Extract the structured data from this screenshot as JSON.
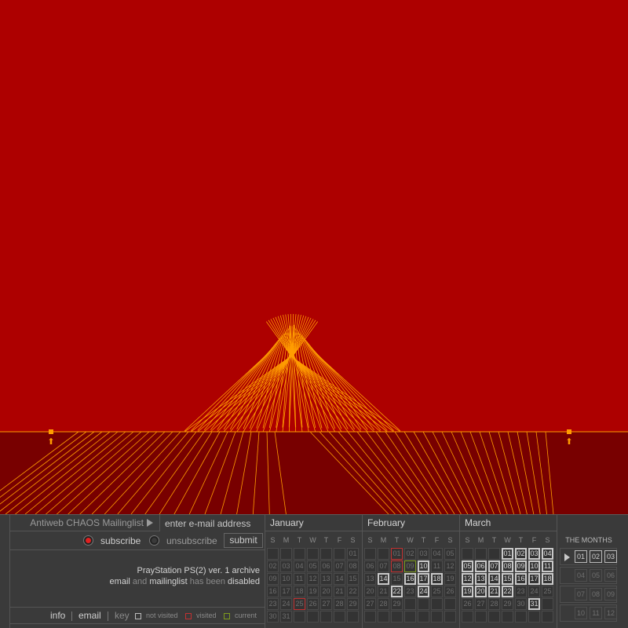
{
  "colors": {
    "background": "#ad0000",
    "floor": "#780000",
    "line": "#ff9d00",
    "panel": "#3a3a3a"
  },
  "markers": [
    {
      "name": "left-handle",
      "icon": "arrow-up-icon",
      "glyph": "⬆"
    },
    {
      "name": "right-handle",
      "icon": "arrow-up-icon",
      "glyph": "⬆"
    }
  ],
  "mailinglist": {
    "label": "Antiweb CHAOS Mailinglist",
    "email_placeholder": "enter e-mail address",
    "subscribe_label": "subscribe",
    "unsubscribe_label": "unsubscribe",
    "submit_label": "submit",
    "info_title": "PrayStation PS(2) ver. 1 archive",
    "status": {
      "w1": "email",
      "w2": "and",
      "w3": "mailinglist",
      "w4": "has been",
      "w5": "disabled"
    }
  },
  "footer": {
    "info_label": "info",
    "email_label": "email",
    "key_label": "key",
    "not_visited_label": "not visited",
    "visited_label": "visited",
    "current_label": "current"
  },
  "dow": [
    "S",
    "M",
    "T",
    "W",
    "T",
    "F",
    "S"
  ],
  "calendar": [
    {
      "name": "January",
      "offset": 6,
      "days": 31,
      "visited": [
        25
      ],
      "current": [],
      "bold": []
    },
    {
      "name": "February",
      "offset": 2,
      "days": 29,
      "visited": [
        1,
        8
      ],
      "current": [
        9
      ],
      "bold": [
        10,
        14,
        16,
        17,
        18,
        22,
        24
      ]
    },
    {
      "name": "March",
      "offset": 3,
      "days": 31,
      "visited": [],
      "current": [],
      "bold": [
        1,
        2,
        3,
        4,
        5,
        6,
        7,
        8,
        9,
        10,
        11,
        12,
        13,
        14,
        15,
        16,
        17,
        18,
        19,
        20,
        21,
        22,
        31
      ]
    }
  ],
  "the_months": {
    "title": "THE MONTHS",
    "groups": [
      {
        "months": [
          "01",
          "02",
          "03"
        ],
        "bold": true,
        "active": true
      },
      {
        "months": [
          "04",
          "05",
          "06"
        ],
        "bold": false,
        "active": false
      },
      {
        "months": [
          "07",
          "08",
          "09"
        ],
        "bold": false,
        "active": false
      },
      {
        "months": [
          "10",
          "11",
          "12"
        ],
        "bold": false,
        "active": false
      }
    ]
  }
}
